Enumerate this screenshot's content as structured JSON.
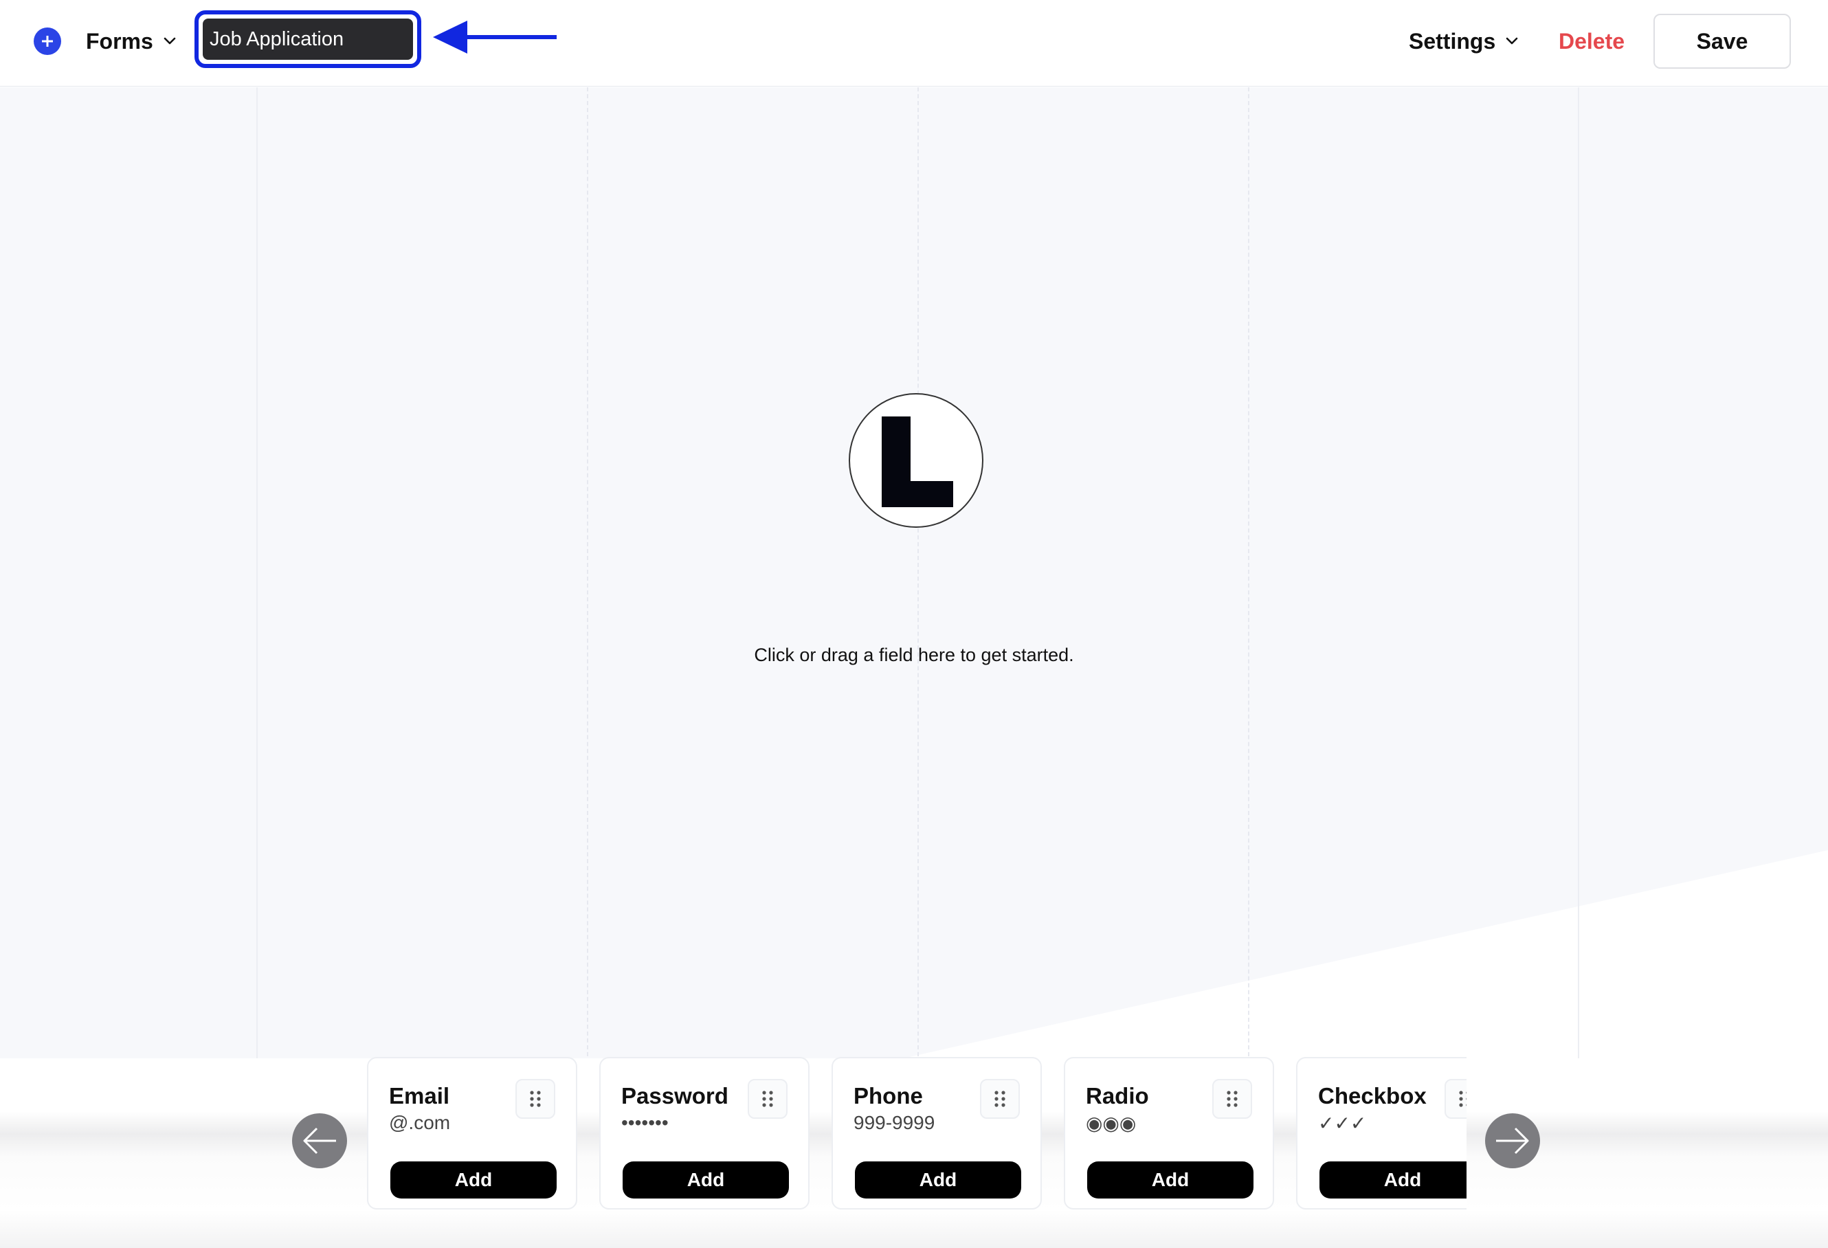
{
  "header": {
    "add_icon": "plus-icon",
    "forms_label": "Forms",
    "form_title_value": "Job Application",
    "settings_label": "Settings",
    "delete_label": "Delete",
    "save_label": "Save"
  },
  "canvas": {
    "empty_hint": "Click or drag a field here to get started."
  },
  "palette": {
    "fields": [
      {
        "title": "Email",
        "sample": "@.com",
        "add_label": "Add"
      },
      {
        "title": "Password",
        "sample": "•••••••",
        "add_label": "Add"
      },
      {
        "title": "Phone",
        "sample": "999-9999",
        "add_label": "Add"
      },
      {
        "title": "Radio",
        "sample": "◉◉◉",
        "add_label": "Add"
      },
      {
        "title": "Checkbox",
        "sample": "✓✓✓",
        "add_label": "Add"
      }
    ]
  },
  "colors": {
    "accent": "#2b44e6",
    "annotation": "#1127e0",
    "danger": "#e5484d",
    "canvas_bg": "#f7f8fb"
  }
}
